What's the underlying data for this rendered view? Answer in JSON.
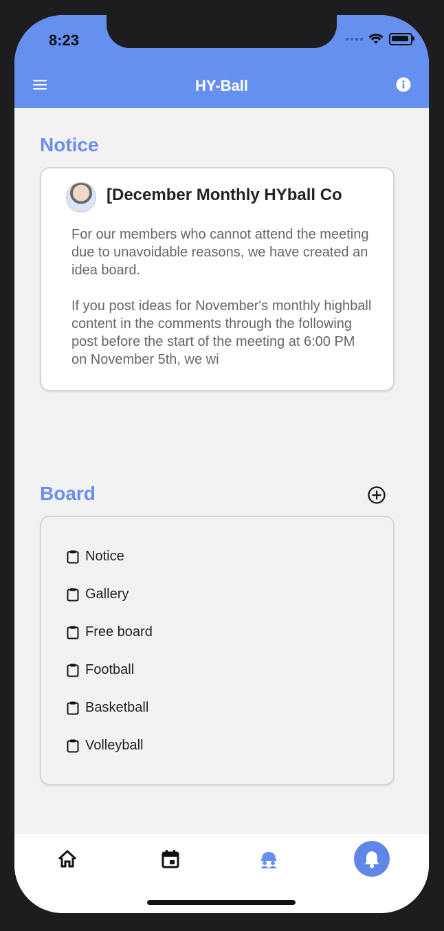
{
  "status": {
    "time": "8:23"
  },
  "appbar": {
    "title": "HY-Ball"
  },
  "notice": {
    "section_label": "Notice",
    "card": {
      "title": "[December Monthly HYball Co",
      "body": "For our members who cannot attend the meeting due to unavoidable reasons, we have created an idea board.\n\nIf you post ideas for November's monthly highball content in the comments through the following post before the start of the meeting at 6:00 PM on November 5th, we wi"
    }
  },
  "board": {
    "section_label": "Board",
    "items": [
      {
        "label": "Notice"
      },
      {
        "label": "Gallery"
      },
      {
        "label": "Free board"
      },
      {
        "label": "Football"
      },
      {
        "label": "Basketball"
      },
      {
        "label": "Volleyball"
      }
    ]
  },
  "bottom_nav": {
    "items": [
      {
        "icon": "home-icon"
      },
      {
        "icon": "calendar-icon"
      },
      {
        "icon": "community-icon"
      },
      {
        "icon": "bell-icon"
      }
    ]
  },
  "colors": {
    "accent": "#6a8ef0",
    "appbar": "#6690f0",
    "background": "#f2f2f2"
  }
}
